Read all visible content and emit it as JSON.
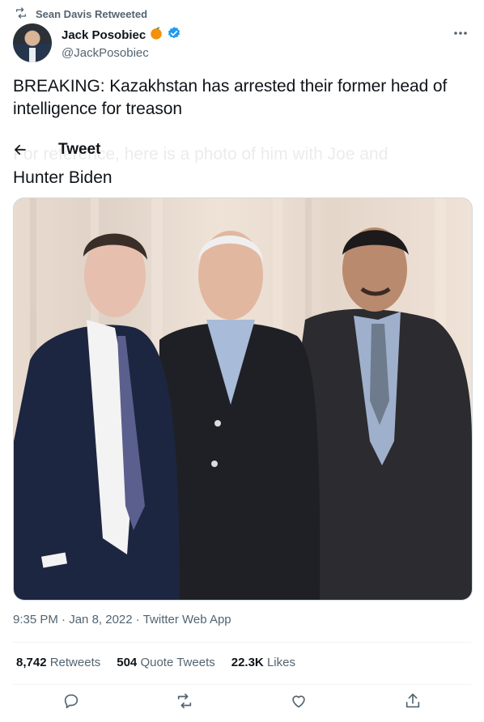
{
  "retweet_context": {
    "icon": "retweet-icon",
    "text": "Sean Davis Retweeted"
  },
  "author": {
    "display_name": "Jack Posobiec",
    "handle": "@JackPosobiec",
    "badge_emoji_icon": "orange-icon",
    "verified": true
  },
  "header": {
    "title": "Tweet",
    "back_icon": "arrow-left-icon"
  },
  "tweet": {
    "text": "BREAKING: Kazakhstan has arrested their former head of intelligence for treason",
    "faded_line": "For reference, here is a photo of him with Joe and",
    "continuation": "Hunter Biden"
  },
  "meta": {
    "time": "9:35 PM",
    "date": "Jan 8, 2022",
    "source": "Twitter Web App",
    "separator": "·"
  },
  "stats": {
    "retweets_count": "8,742",
    "retweets_label": "Retweets",
    "quotes_count": "504",
    "quotes_label": "Quote Tweets",
    "likes_count": "22.3K",
    "likes_label": "Likes"
  },
  "actions": [
    "reply-icon",
    "retweet-icon",
    "like-icon",
    "share-icon"
  ],
  "colors": {
    "secondary_text": "#536471",
    "verified": "#1d9bf0",
    "divider": "#eff3f4"
  }
}
